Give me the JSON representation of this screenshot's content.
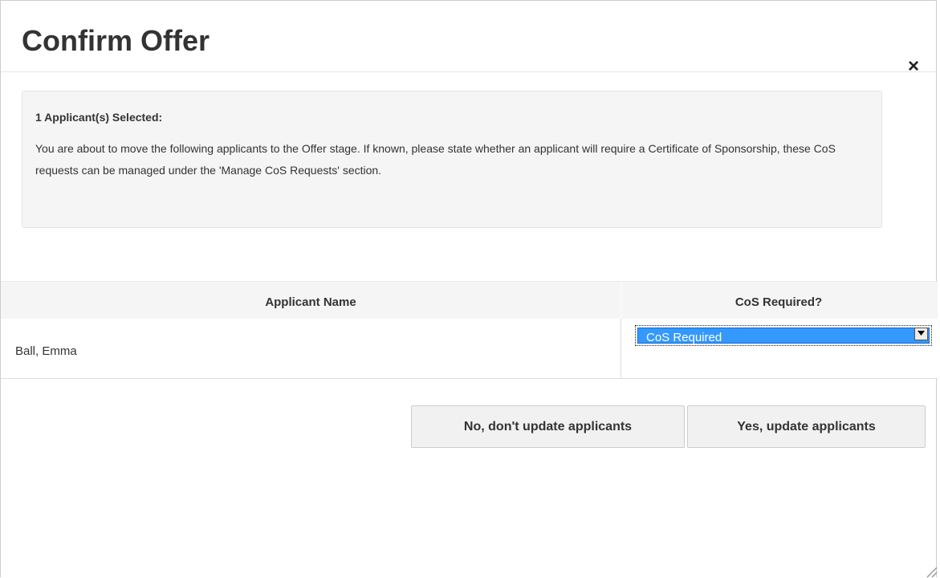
{
  "dialog": {
    "title": "Confirm Offer",
    "close_glyph": "×",
    "close_icon": "close-icon"
  },
  "info": {
    "heading": "1 Applicant(s) Selected:",
    "text": "You are about to move the following applicants to the Offer stage. If known, please state whether an applicant will require a Certificate of Sponsorship, these CoS requests can be managed under the 'Manage CoS Requests' section."
  },
  "table": {
    "headers": [
      "Applicant Name",
      "CoS Required?"
    ],
    "rows": [
      {
        "name": "Ball, Emma",
        "cos_selected": "CoS Required"
      }
    ]
  },
  "buttons": {
    "no_label": "No, don't update applicants",
    "yes_label": "Yes, update applicants"
  },
  "colors": {
    "select_highlight": "#3399ff",
    "header_bg": "#f5f5f5",
    "button_bg": "#f1f1f1"
  }
}
